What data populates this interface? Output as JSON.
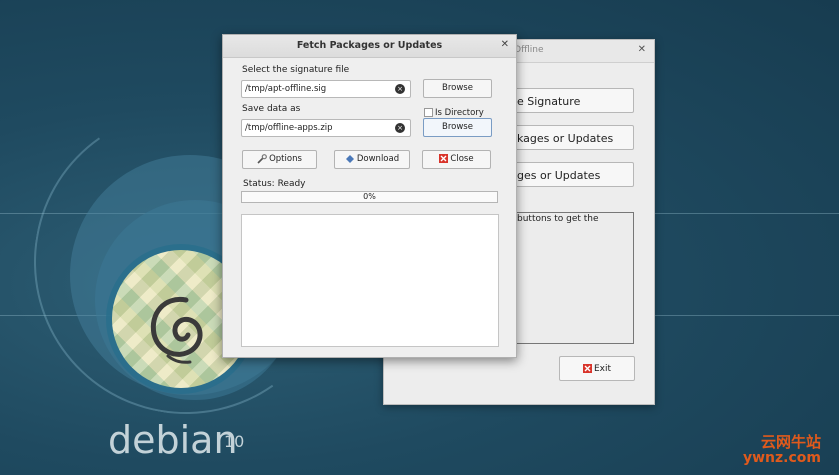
{
  "desktop": {
    "brand": "debian",
    "version": "10",
    "watermark_cn": "云网牛站",
    "watermark_en": "ywnz.com"
  },
  "back_window": {
    "title": "Offline",
    "buttons": [
      "e Signature",
      "kages or Updates",
      "ges or Updates"
    ],
    "text_partial": "buttons to get the",
    "exit_label": "Exit"
  },
  "dialog": {
    "title": "Fetch Packages or Updates",
    "signature_label": "Select the signature file",
    "signature_value": "/tmp/apt-offline.sig",
    "save_label": "Save data as",
    "save_value": "/tmp/offline-apps.zip",
    "browse_label": "Browse",
    "is_directory_label": "Is Directory",
    "options_label": "Options",
    "download_label": "Download",
    "close_label": "Close",
    "status_text": "Status: Ready",
    "progress_value": 0,
    "progress_text": "0%",
    "log_text": ""
  },
  "colors": {
    "desktop_bg": "#1f4a60",
    "progress_fill": "#6a9ad0",
    "close_icon": "#d9342b"
  }
}
